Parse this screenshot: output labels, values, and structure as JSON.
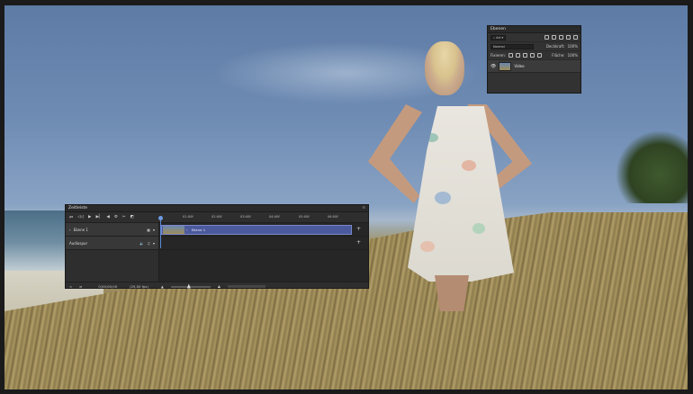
{
  "layers_panel": {
    "title": "Ebenen",
    "filter_kind": "Art",
    "blend_mode": "Normal",
    "opacity_label": "Deckkraft:",
    "opacity_value": "100%",
    "lock_label": "Fixieren:",
    "fill_label": "Fläche:",
    "fill_value": "100%",
    "layers": [
      {
        "name": "Video",
        "visible": true
      }
    ]
  },
  "timeline_panel": {
    "title": "Zeitleiste",
    "ruler_ticks": [
      "01:00f",
      "02:00f",
      "03:00f",
      "04:00f",
      "05:00f",
      "06:00f"
    ],
    "tracks": [
      {
        "name": "Ebene 1",
        "clip_label": "Ebene 1"
      },
      {
        "name": "Audiospur"
      }
    ],
    "timecode": "0;00;00;00",
    "fps": "(25,00 fps)"
  },
  "icons": {
    "visibility": "eye-icon",
    "play": "play-icon",
    "scissors": "scissors-icon",
    "add_media": "plus-icon"
  },
  "colors": {
    "clip": "#4b5a9c",
    "playhead": "#5b8bd9",
    "panel_bg": "#323232"
  }
}
